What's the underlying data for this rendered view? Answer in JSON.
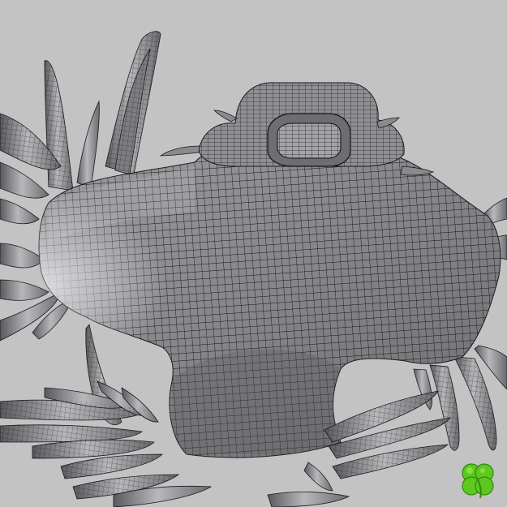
{
  "viewport": {
    "background_color": "#c3c3c3",
    "mesh_fill_color": "#8d8d8f",
    "mesh_highlight_color": "#cfcfd2",
    "mesh_shadow_color": "#4f4f53",
    "wire_color": "#141414"
  },
  "subject": {
    "kind": "wireframe-sculpt-mesh",
    "description_icon": "quad-mesh-creature-icon"
  },
  "watermark": {
    "icon": "four-leaf-clover-logo-icon",
    "color": "#5ec81f",
    "outline_color": "#2f8a0f"
  }
}
